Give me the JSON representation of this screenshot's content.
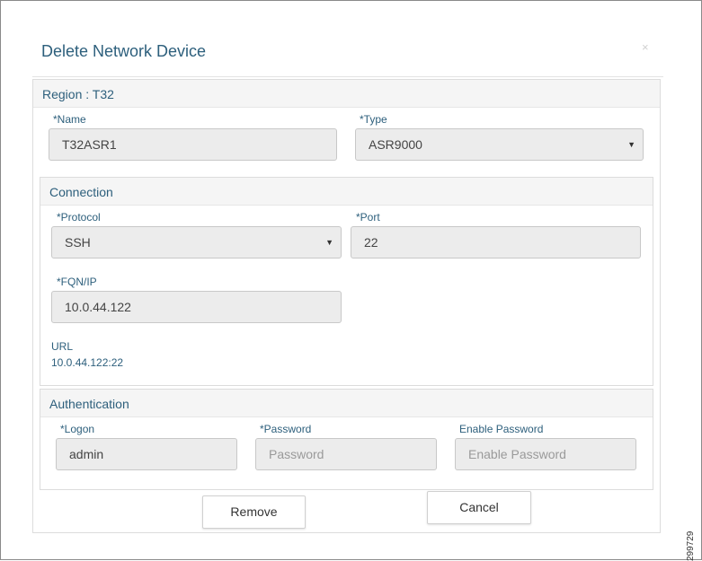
{
  "dialog": {
    "title": "Delete Network Device",
    "close_symbol": "×"
  },
  "region": {
    "heading": "Region : T32",
    "name_label": "*Name",
    "name_value": "T32ASR1",
    "type_label": "*Type",
    "type_value": "ASR9000"
  },
  "connection": {
    "heading": "Connection",
    "protocol_label": "*Protocol",
    "protocol_value": "SSH",
    "port_label": "*Port",
    "port_value": "22",
    "fqn_label": "*FQN/IP",
    "fqn_value": "10.0.44.122",
    "url_label": "URL",
    "url_value": "10.0.44.122:22"
  },
  "authentication": {
    "heading": "Authentication",
    "logon_label": "*Logon",
    "logon_value": "admin",
    "password_label": "*Password",
    "password_placeholder": "Password",
    "enable_label": "Enable Password",
    "enable_placeholder": "Enable Password"
  },
  "buttons": {
    "remove": "Remove",
    "cancel": "Cancel"
  },
  "icons": {
    "close": "close-icon",
    "dropdown": "chevron-down-icon"
  },
  "figure_id": "299729",
  "colors": {
    "heading_text": "#2d5f7c",
    "field_bg": "#ececec"
  }
}
